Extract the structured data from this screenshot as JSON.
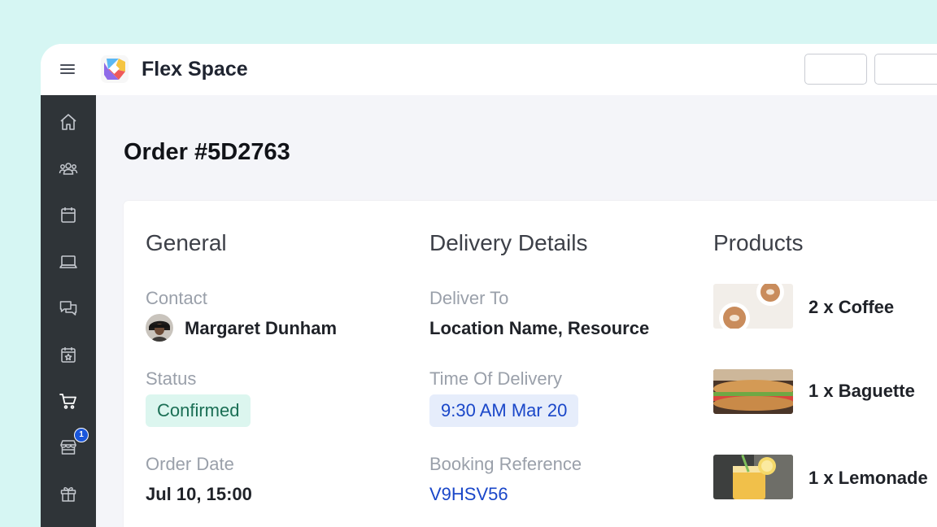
{
  "app": {
    "brand": "Flex Space"
  },
  "page": {
    "title": "Order #5D2763"
  },
  "sidebar": {
    "items": [
      {
        "name": "home-icon"
      },
      {
        "name": "users-icon"
      },
      {
        "name": "calendar-icon"
      },
      {
        "name": "laptop-icon"
      },
      {
        "name": "chat-icon"
      },
      {
        "name": "event-calendar-icon"
      },
      {
        "name": "cart-icon"
      },
      {
        "name": "store-icon",
        "badge": "1"
      },
      {
        "name": "gift-icon"
      }
    ]
  },
  "general": {
    "title": "General",
    "contact_label": "Contact",
    "contact_name": "Margaret Dunham",
    "status_label": "Status",
    "status_value": "Confirmed",
    "order_date_label": "Order Date",
    "order_date_value": "Jul 10, 15:00"
  },
  "delivery": {
    "title": "Delivery Details",
    "deliver_to_label": "Deliver To",
    "deliver_to_value": "Location Name, Resource",
    "time_label": "Time Of Delivery",
    "time_value": "9:30 AM Mar 20",
    "booking_label": "Booking Reference",
    "booking_value": "V9HSV56"
  },
  "products": {
    "title": "Products",
    "items": [
      {
        "name": "2 x Coffee"
      },
      {
        "name": "1 x Baguette"
      },
      {
        "name": "1 x Lemonade"
      }
    ]
  },
  "colors": {
    "background": "#d6f6f3",
    "sidebar": "#2f3438",
    "accent": "#1a47c9",
    "status_green": "#1b6f55",
    "badge": "#1a56db"
  }
}
